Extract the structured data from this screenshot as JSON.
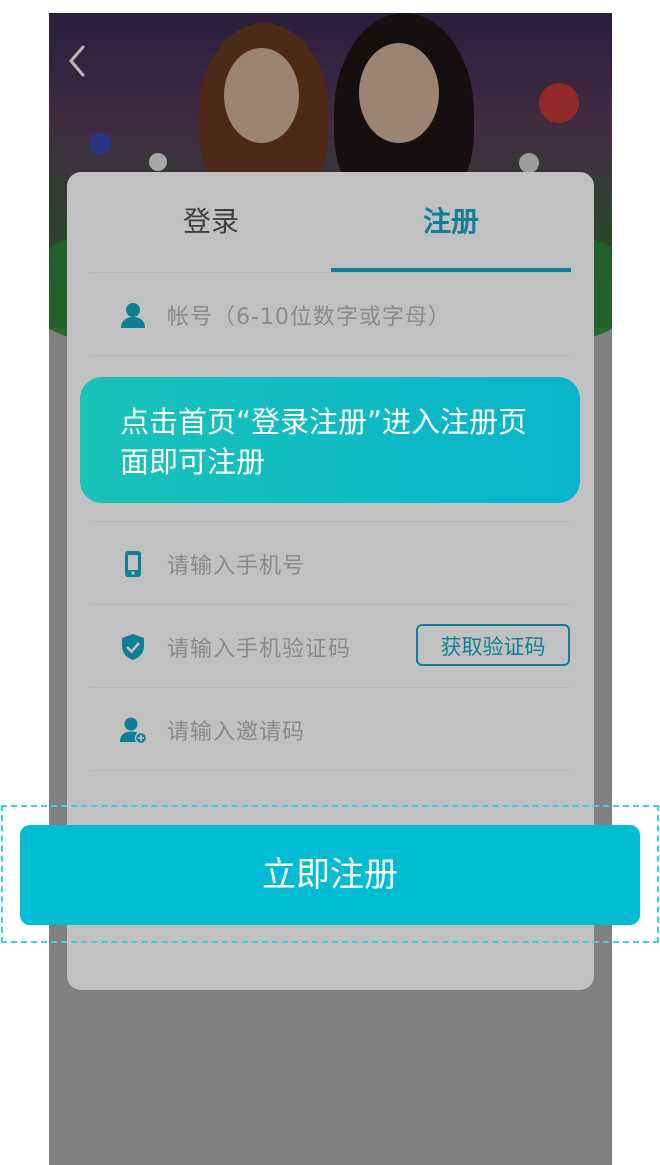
{
  "tabs": {
    "login": "登录",
    "register": "注册"
  },
  "fields": {
    "account_placeholder": "帐号（6-10位数字或字母）",
    "phone_placeholder": "请输入手机号",
    "code_placeholder": "请输入手机验证码",
    "invite_placeholder": "请输入邀请码"
  },
  "buttons": {
    "get_code": "获取验证码",
    "submit": "立即注册"
  },
  "tooltip": {
    "line1": "点击首页“登录注册”进入注册页",
    "line2": "面即可注册"
  },
  "icons": {
    "back": "chevron-left-icon",
    "account": "user-icon",
    "phone": "phone-icon",
    "code": "shield-check-icon",
    "invite": "user-add-icon"
  },
  "colors": {
    "accent": "#0e7f95",
    "button": "#02bcd4",
    "tooltip_start": "#19c3b8",
    "tooltip_end": "#08b5cd"
  }
}
